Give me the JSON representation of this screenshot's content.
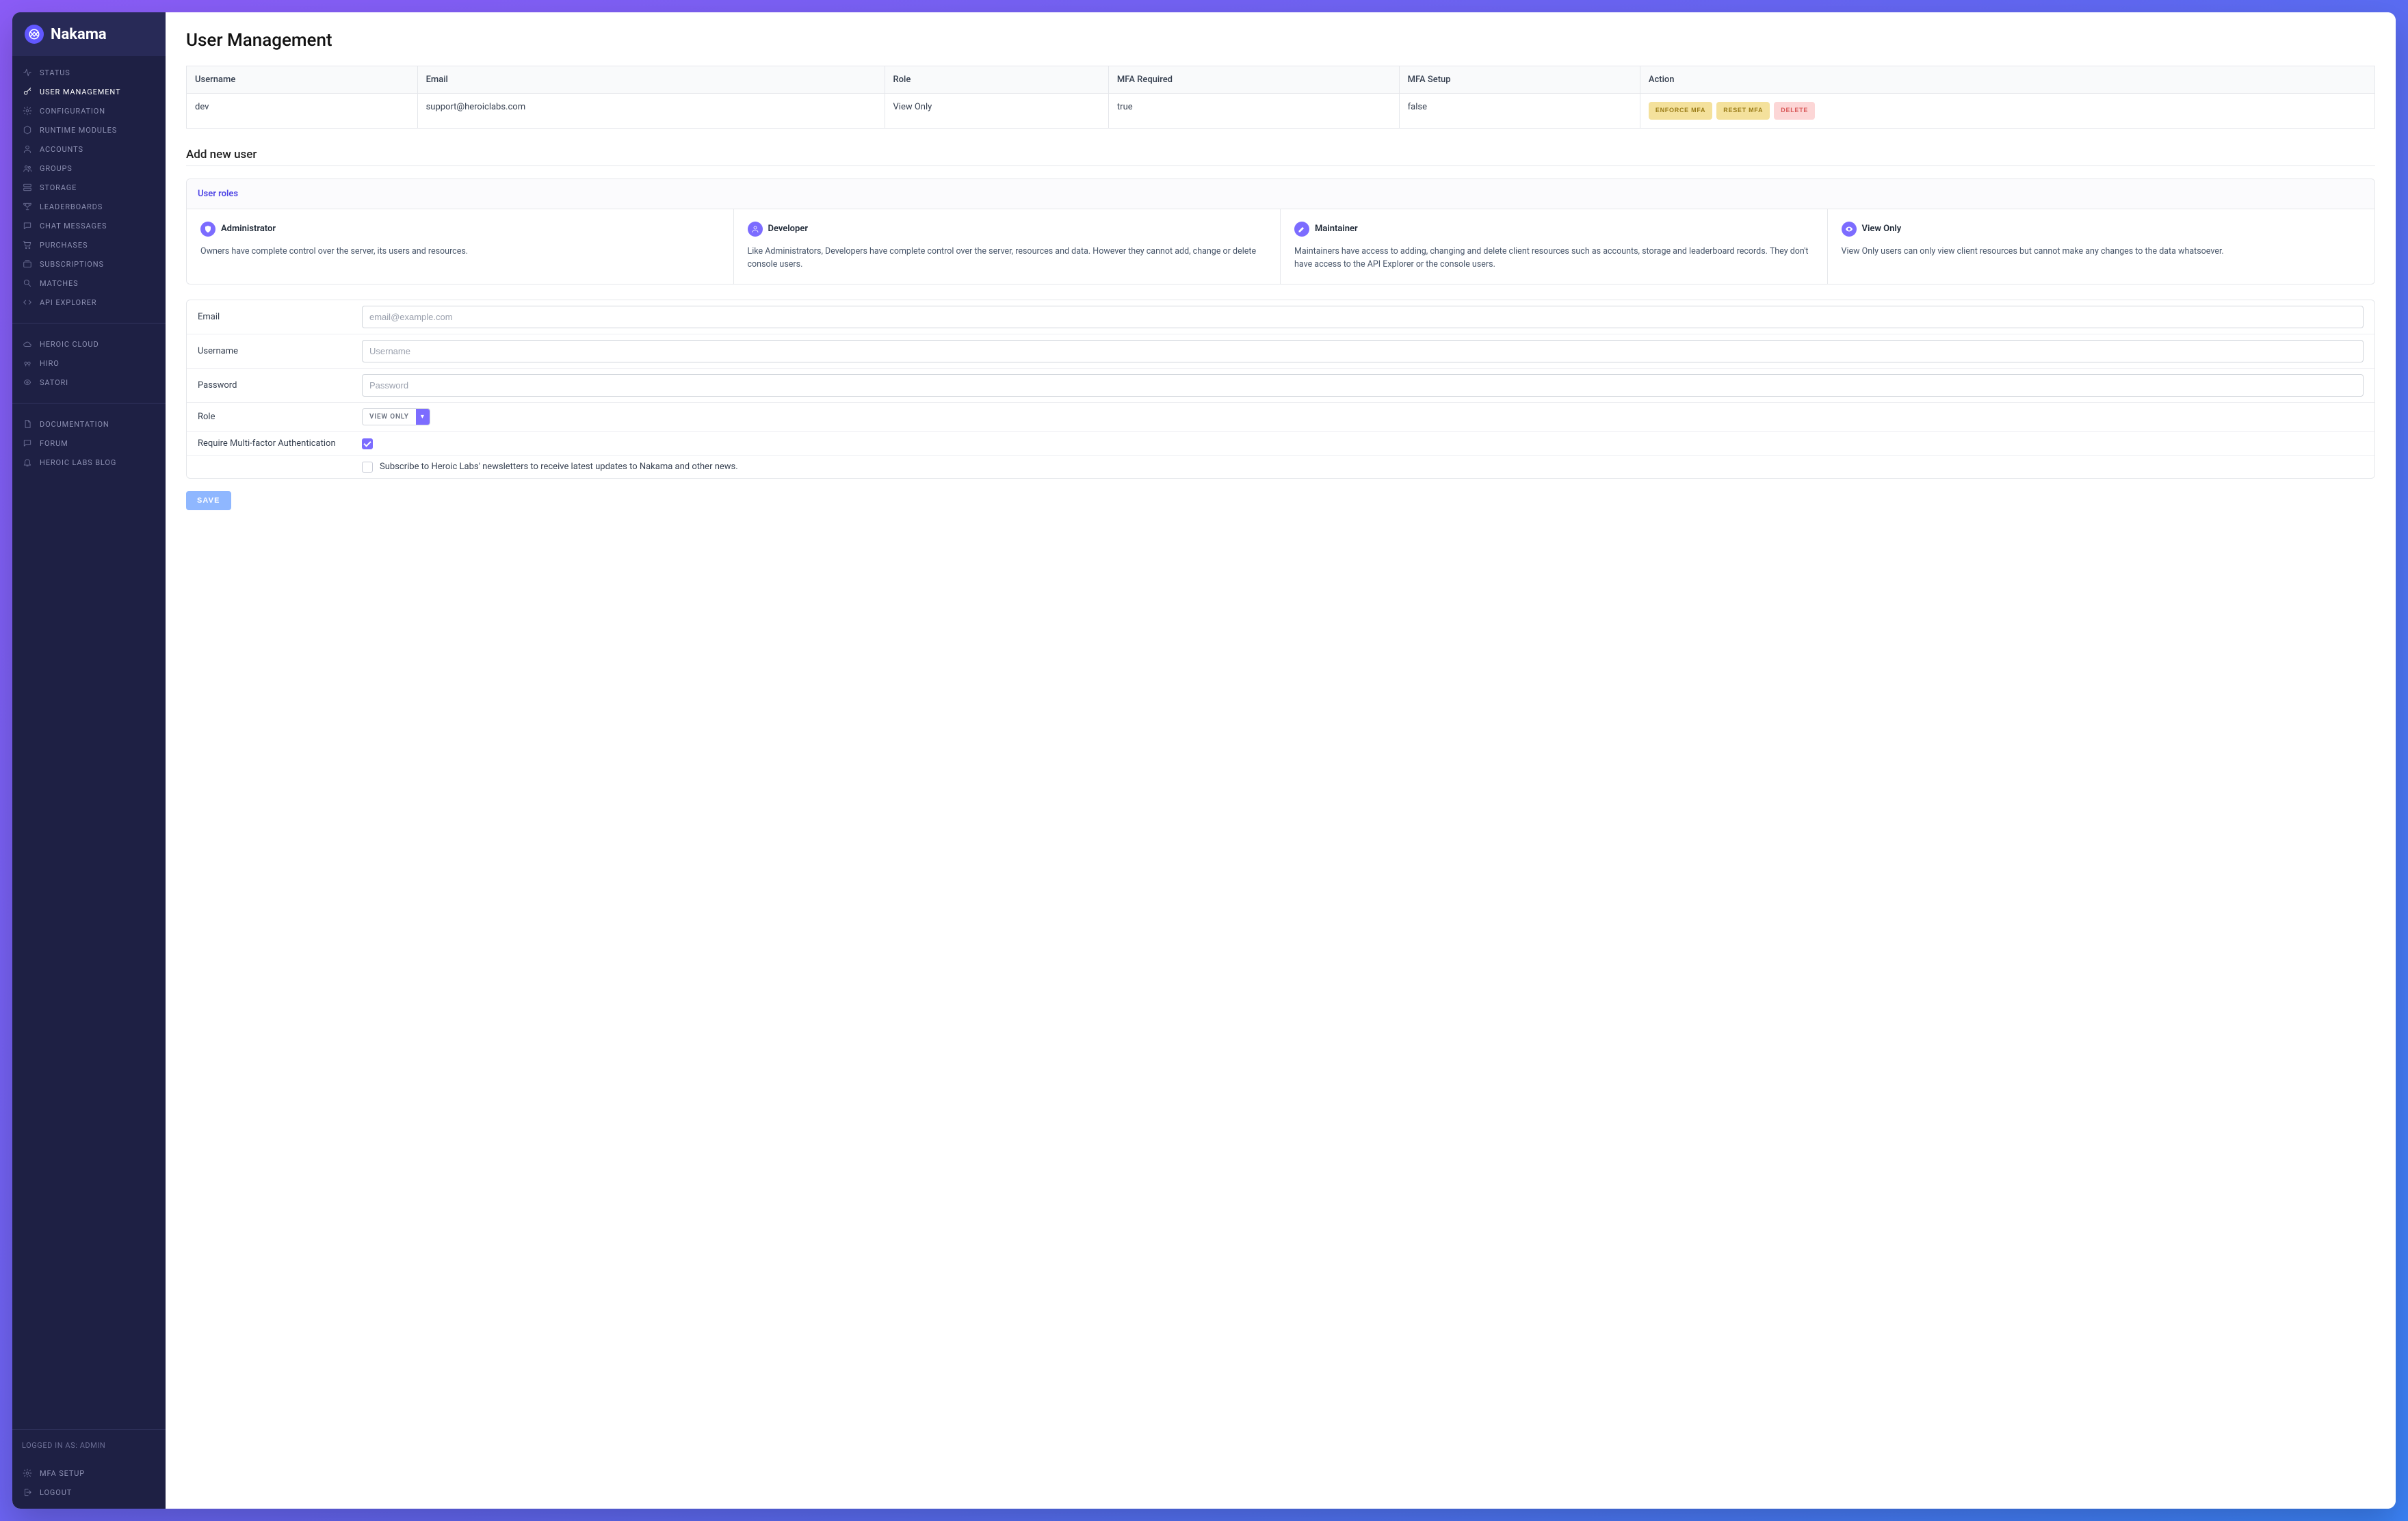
{
  "brand": {
    "name": "Nakama"
  },
  "sidebar": {
    "main_nav": [
      {
        "label": "STATUS",
        "icon": "activity",
        "slug": "status"
      },
      {
        "label": "USER MANAGEMENT",
        "icon": "key",
        "slug": "user-management",
        "active": true
      },
      {
        "label": "CONFIGURATION",
        "icon": "gear",
        "slug": "configuration"
      },
      {
        "label": "RUNTIME MODULES",
        "icon": "hexagon",
        "slug": "runtime-modules"
      },
      {
        "label": "ACCOUNTS",
        "icon": "user",
        "slug": "accounts"
      },
      {
        "label": "GROUPS",
        "icon": "users",
        "slug": "groups"
      },
      {
        "label": "STORAGE",
        "icon": "storage",
        "slug": "storage"
      },
      {
        "label": "LEADERBOARDS",
        "icon": "trophy",
        "slug": "leaderboards"
      },
      {
        "label": "CHAT MESSAGES",
        "icon": "chat",
        "slug": "chat-messages"
      },
      {
        "label": "PURCHASES",
        "icon": "cart",
        "slug": "purchases"
      },
      {
        "label": "SUBSCRIPTIONS",
        "icon": "subscriptions",
        "slug": "subscriptions"
      },
      {
        "label": "MATCHES",
        "icon": "matches",
        "slug": "matches"
      },
      {
        "label": "API EXPLORER",
        "icon": "code",
        "slug": "api-explorer"
      }
    ],
    "external_nav": [
      {
        "label": "HEROIC CLOUD",
        "icon": "cloud",
        "slug": "heroic-cloud"
      },
      {
        "label": "HIRO",
        "icon": "hiro",
        "slug": "hiro"
      },
      {
        "label": "SATORI",
        "icon": "satori",
        "slug": "satori"
      }
    ],
    "docs_nav": [
      {
        "label": "DOCUMENTATION",
        "icon": "doc",
        "slug": "documentation"
      },
      {
        "label": "FORUM",
        "icon": "forum",
        "slug": "forum"
      },
      {
        "label": "HEROIC LABS BLOG",
        "icon": "bell",
        "slug": "blog"
      }
    ],
    "logged_in_as": "LOGGED IN AS: ADMIN",
    "footer_nav": [
      {
        "label": "MFA SETUP",
        "icon": "gear",
        "slug": "mfa-setup"
      },
      {
        "label": "LOGOUT",
        "icon": "logout",
        "slug": "logout"
      }
    ]
  },
  "page": {
    "title": "User Management",
    "table": {
      "headers": {
        "username": "Username",
        "email": "Email",
        "role": "Role",
        "mfa_required": "MFA Required",
        "mfa_setup": "MFA Setup",
        "action": "Action"
      },
      "rows": [
        {
          "username": "dev",
          "email": "support@heroiclabs.com",
          "role": "View Only",
          "mfa_required": "true",
          "mfa_setup": "false",
          "actions": {
            "enforce_mfa": "ENFORCE MFA",
            "reset_mfa": "RESET MFA",
            "delete": "DELETE"
          }
        }
      ]
    },
    "add_user": {
      "section_title": "Add new user",
      "roles_header": "User roles",
      "roles": [
        {
          "name": "Administrator",
          "icon": "shield",
          "desc": "Owners have complete control over the server, its users and resources."
        },
        {
          "name": "Developer",
          "icon": "user",
          "desc": "Like Administrators, Developers have complete control over the server, resources and data. However they cannot add, change or delete console users."
        },
        {
          "name": "Maintainer",
          "icon": "pencil",
          "desc": "Maintainers have access to adding, changing and delete client resources such as accounts, storage and leaderboard records. They don't have access to the API Explorer or the console users."
        },
        {
          "name": "View Only",
          "icon": "eye",
          "desc": "View Only users can only view client resources but cannot make any changes to the data whatsoever."
        }
      ],
      "form": {
        "email_label": "Email",
        "email_placeholder": "email@example.com",
        "username_label": "Username",
        "username_placeholder": "Username",
        "password_label": "Password",
        "password_placeholder": "Password",
        "role_label": "Role",
        "role_select_value": "VIEW ONLY",
        "require_mfa_label": "Require Multi-factor Authentication",
        "require_mfa_checked": true,
        "subscribe_checked": false,
        "subscribe_text": "Subscribe to Heroic Labs' newsletters to receive latest updates to Nakama and other news.",
        "save_label": "SAVE"
      }
    }
  }
}
